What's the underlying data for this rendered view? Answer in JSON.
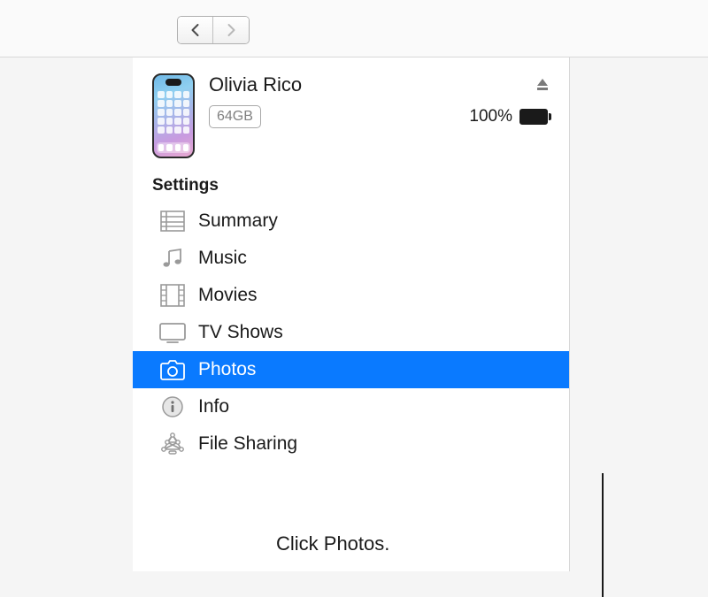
{
  "device": {
    "name": "Olivia Rico",
    "capacity": "64GB",
    "battery_percent": "100%"
  },
  "sidebar": {
    "section_title": "Settings",
    "items": [
      {
        "label": "Summary",
        "icon": "summary-icon",
        "selected": false
      },
      {
        "label": "Music",
        "icon": "music-icon",
        "selected": false
      },
      {
        "label": "Movies",
        "icon": "movies-icon",
        "selected": false
      },
      {
        "label": "TV Shows",
        "icon": "tv-icon",
        "selected": false
      },
      {
        "label": "Photos",
        "icon": "photos-icon",
        "selected": true
      },
      {
        "label": "Info",
        "icon": "info-icon",
        "selected": false
      },
      {
        "label": "File Sharing",
        "icon": "file-sharing-icon",
        "selected": false
      }
    ]
  },
  "callout": {
    "text": "Click Photos."
  },
  "colors": {
    "selection": "#0a7aff"
  }
}
